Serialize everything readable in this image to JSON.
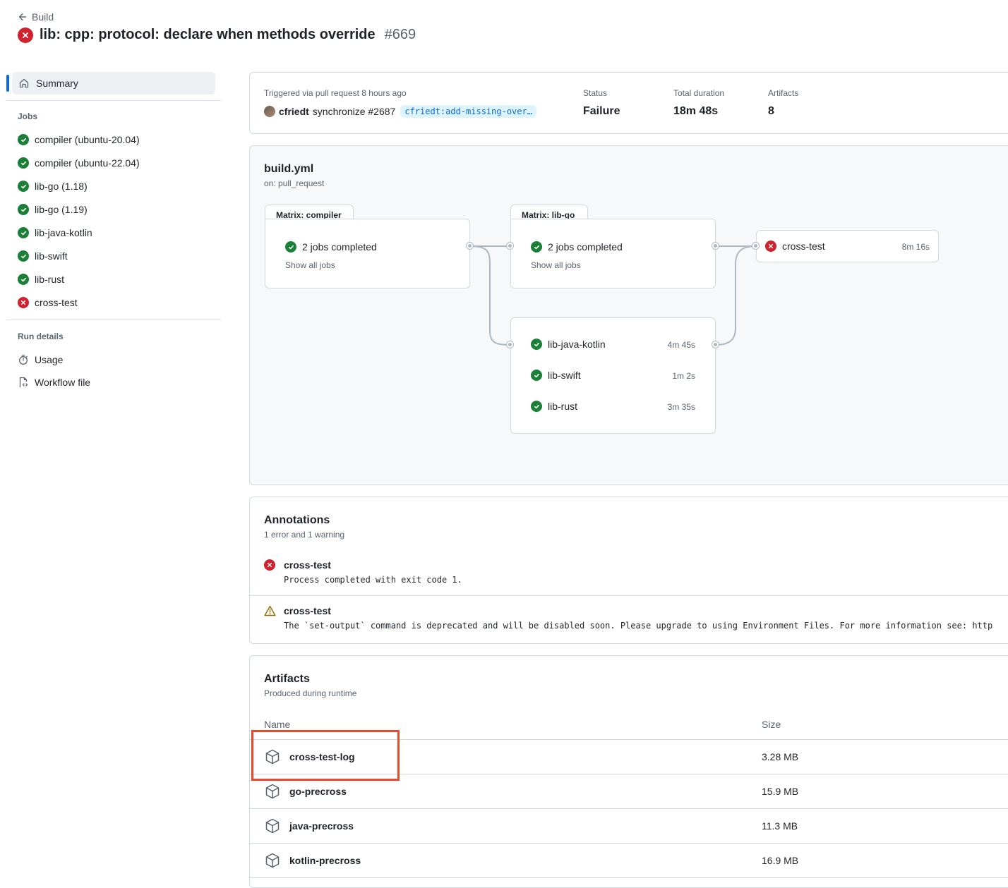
{
  "header": {
    "back_label": "Build",
    "title": "lib: cpp: protocol: declare when methods override",
    "run_number": "#669"
  },
  "sidebar": {
    "summary_label": "Summary",
    "jobs_heading": "Jobs",
    "jobs": [
      {
        "label": "compiler (ubuntu-20.04)",
        "status": "success"
      },
      {
        "label": "compiler (ubuntu-22.04)",
        "status": "success"
      },
      {
        "label": "lib-go (1.18)",
        "status": "success"
      },
      {
        "label": "lib-go (1.19)",
        "status": "success"
      },
      {
        "label": "lib-java-kotlin",
        "status": "success"
      },
      {
        "label": "lib-swift",
        "status": "success"
      },
      {
        "label": "lib-rust",
        "status": "success"
      },
      {
        "label": "cross-test",
        "status": "failure"
      }
    ],
    "run_details_heading": "Run details",
    "usage_label": "Usage",
    "workflow_file_label": "Workflow file"
  },
  "summary_card": {
    "triggered_text": "Triggered via pull request 8 hours ago",
    "actor": "cfriedt",
    "action": "synchronize #2687",
    "branch": "cfriedt:add-missing-over…",
    "status_label": "Status",
    "status_value": "Failure",
    "duration_label": "Total duration",
    "duration_value": "18m 48s",
    "artifacts_label": "Artifacts",
    "artifacts_value": "8"
  },
  "workflow": {
    "file": "build.yml",
    "trigger": "on: pull_request",
    "matrix_compiler": {
      "tab": "Matrix: compiler",
      "summary": "2 jobs completed",
      "link": "Show all jobs"
    },
    "matrix_libgo": {
      "tab": "Matrix: lib-go",
      "summary": "2 jobs completed",
      "link": "Show all jobs"
    },
    "group_jobs": [
      {
        "label": "lib-java-kotlin",
        "duration": "4m 45s"
      },
      {
        "label": "lib-swift",
        "duration": "1m 2s"
      },
      {
        "label": "lib-rust",
        "duration": "3m 35s"
      }
    ],
    "cross_test": {
      "label": "cross-test",
      "duration": "8m 16s"
    }
  },
  "annotations": {
    "title": "Annotations",
    "subtitle": "1 error and 1 warning",
    "items": [
      {
        "type": "error",
        "title": "cross-test",
        "message": "Process completed with exit code 1."
      },
      {
        "type": "warning",
        "title": "cross-test",
        "message": "The `set-output` command is deprecated and will be disabled soon. Please upgrade to using Environment Files. For more information see: http"
      }
    ]
  },
  "artifacts": {
    "title": "Artifacts",
    "subtitle": "Produced during runtime",
    "col_name": "Name",
    "col_size": "Size",
    "rows": [
      {
        "name": "cross-test-log",
        "size": "3.28 MB"
      },
      {
        "name": "go-precross",
        "size": "15.9 MB"
      },
      {
        "name": "java-precross",
        "size": "11.3 MB"
      },
      {
        "name": "kotlin-precross",
        "size": "16.9 MB"
      }
    ]
  },
  "colors": {
    "success": "#1a7f37",
    "failure": "#cf222e",
    "accent": "#0969da",
    "highlight": "#e8492a"
  }
}
